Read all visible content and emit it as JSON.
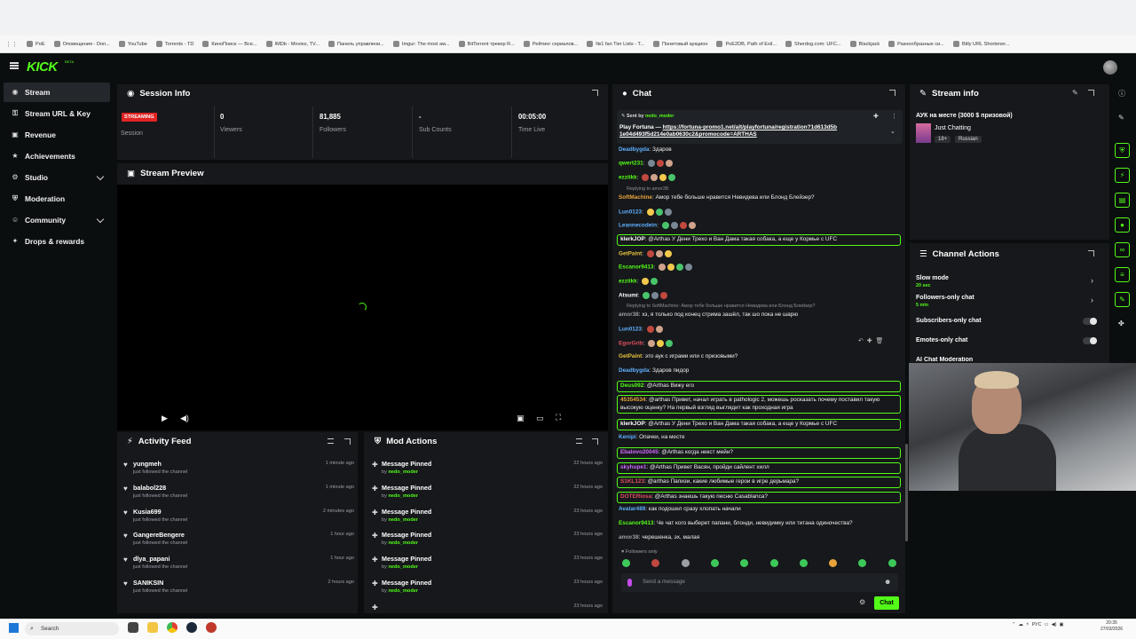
{
  "bookmarks": [
    "PoE",
    "Оповещения - Don...",
    "YouTube",
    "Torrents - TD",
    "КиноПоиск — Все...",
    "IMDb - Movies, TV...",
    "Панель управлени...",
    "Imgur: The most aw...",
    "BitTorrent трекер R...",
    "Рейтинг сериалов...",
    "№1 fan Tier Lists - T...",
    "Понитовый аукцион",
    "PoE2DB, Path of Exil...",
    "Sherdog.com: UFC...",
    "Blackjack",
    "Разнообразные си...",
    "Bitly URL Shortener..."
  ],
  "brand": {
    "logo": "KICK",
    "beta": "BETA",
    "accent": "#53fc18"
  },
  "sidebar": {
    "items": [
      {
        "label": "Stream",
        "icon": "radio-icon"
      },
      {
        "label": "Stream URL & Key",
        "icon": "key-icon"
      },
      {
        "label": "Revenue",
        "icon": "revenue-icon"
      },
      {
        "label": "Achievements",
        "icon": "star-icon"
      },
      {
        "label": "Studio",
        "icon": "studio-icon"
      },
      {
        "label": "Moderation",
        "icon": "shield-icon"
      },
      {
        "label": "Community",
        "icon": "people-icon"
      },
      {
        "label": "Drops & rewards",
        "icon": "gift-icon"
      }
    ]
  },
  "session": {
    "title": "Session Info",
    "badge": "STREAMING",
    "status_label": "Session",
    "cells": [
      {
        "value": "0",
        "label": "Viewers"
      },
      {
        "value": "81,885",
        "label": "Followers"
      },
      {
        "value": "-",
        "label": "Sub Counts"
      },
      {
        "value": "00:05:00",
        "label": "Time Live"
      }
    ]
  },
  "preview": {
    "title": "Stream Preview"
  },
  "activity": {
    "title": "Activity Feed",
    "rows": [
      {
        "name": "yungmeh",
        "sub": "just followed the channel",
        "time": "1 minute ago"
      },
      {
        "name": "balabol228",
        "sub": "just followed the channel",
        "time": "1 minute ago"
      },
      {
        "name": "Kusia699",
        "sub": "just followed the channel",
        "time": "2 minutes ago"
      },
      {
        "name": "GangereBengere",
        "sub": "just followed the channel",
        "time": "1 hour ago"
      },
      {
        "name": "dlya_papani",
        "sub": "just followed the channel",
        "time": "1 hour ago"
      },
      {
        "name": "SANIKSIN",
        "sub": "just followed the channel",
        "time": "2 hours ago"
      }
    ]
  },
  "mod": {
    "title": "Mod Actions",
    "by_prefix": "by",
    "rows": [
      {
        "action": "Message Pinned",
        "by": "nedo_moder",
        "time": "22 hours ago"
      },
      {
        "action": "Message Pinned",
        "by": "nedo_moder",
        "time": "22 hours ago"
      },
      {
        "action": "Message Pinned",
        "by": "nedo_moder",
        "time": "23 hours ago"
      },
      {
        "action": "Message Pinned",
        "by": "nedo_moder",
        "time": "23 hours ago"
      },
      {
        "action": "Message Pinned",
        "by": "nedo_moder",
        "time": "23 hours ago"
      },
      {
        "action": "Message Pinned",
        "by": "nedo_moder",
        "time": "23 hours ago"
      },
      {
        "action": "",
        "by": "",
        "time": "23 hours ago"
      }
    ]
  },
  "chat": {
    "title": "Chat",
    "pinned": {
      "sent_by": "Sent by",
      "user": "nedo_moder",
      "text": "Play Fortuna — ",
      "link": "https://fortuna-promo1.net/alt/playfortuna/registration?1d613d5b1e04d493f5d214e0ab0630c2&promocode=ARTHAS"
    },
    "messages": [
      {
        "user": "Deadbygda",
        "color": "#5fb0ff",
        "text": "Здаров",
        "hl": false
      },
      {
        "user": "qwert231",
        "color": "#53fc18",
        "text": "",
        "hl": false
      },
      {
        "user": "ezziikk",
        "color": "#53fc18",
        "text": "",
        "hl": false
      },
      {
        "reply": "Replying to amor38:",
        "user": "SoftMachine",
        "color": "#e8a23b",
        "text": "Амор тебе больше нравится Невидева или Блонд Блейзер?",
        "hl": false
      },
      {
        "user": "Lun0123",
        "color": "#5fb0ff",
        "text": "",
        "hl": false
      },
      {
        "user": "Leannecodein",
        "color": "#5fb0ff",
        "text": "",
        "hl": false
      },
      {
        "user": "klerkJOP",
        "color": "#ffffff",
        "text": "@Arthas У Дени Трехо и Ван Дама такая собака, а еще у Кормье с UFC",
        "hl": true
      },
      {
        "user": "GetPaint",
        "color": "#e8c33b",
        "text": "",
        "hl": false
      },
      {
        "user": "Escanor9413",
        "color": "#53fc18",
        "text": "",
        "hl": false
      },
      {
        "user": "ezziikk",
        "color": "#53fc18",
        "text": "",
        "hl": false
      },
      {
        "user": "Atsumi",
        "color": "#ffffff",
        "text": "",
        "hl": false
      },
      {
        "reply": "Replying to SoftMachine: Амор тебе больше нравится Невидева или Блонд Блейзер?",
        "user": "amor38",
        "color": "#9aa0a6",
        "text": "хз, я только под конец стрима зашёл, так шо пока не шарю",
        "hl": false
      },
      {
        "user": "Lun0123",
        "color": "#5fb0ff",
        "text": "",
        "hl": false
      },
      {
        "user": "EgorGrib",
        "color": "#e04f5f",
        "text": "",
        "hl": false
      },
      {
        "user": "GetPaint",
        "color": "#e8c33b",
        "text": "это аук с играми или с призовыми?",
        "hl": false
      },
      {
        "user": "Deadbygda",
        "color": "#5fb0ff",
        "text": "Здаров пидор",
        "hl": false
      },
      {
        "user": "Deus092",
        "color": "#53fc18",
        "text": "@Arthas Вижу его",
        "hl": true
      },
      {
        "user": "45354534",
        "color": "#e8a23b",
        "text": "@arthas Привет, начал играть в pathologic 2, можешь росказать почему поставил такую высокую оценку? На первый взгляд выглядит как проходная игра",
        "hl": true
      },
      {
        "user": "klerkJOP",
        "color": "#ffffff",
        "text": "@Arthas У Дени Трехо и Ван Дама такая собака, а еще у Кормье с UFC",
        "hl": true
      },
      {
        "user": "Kenipi",
        "color": "#5fb0ff",
        "text": "Опачки, на месте",
        "hl": false
      },
      {
        "user": "Ebalovo20045",
        "color": "#d06bff",
        "text": "@Arthas когда некст мейн?",
        "hl": true
      },
      {
        "user": "skyhupe1",
        "color": "#d06bff",
        "text": "@Arthas Привет Васян, пройди сайлент хилл",
        "hl": true
      },
      {
        "user": "S1KL123",
        "color": "#e04f5f",
        "text": "@arthas Папизи, какие любимые герои в игре дерьмара?",
        "hl": true
      },
      {
        "user": "DOTERiosa",
        "color": "#e04f5f",
        "text": "@Arthas знаешь такую песню Casablanca?",
        "hl": true
      },
      {
        "user": "Avatar489",
        "color": "#5fb0ff",
        "text": "как подошел сразу хлопать начали",
        "hl": false
      },
      {
        "user": "Escanor9413",
        "color": "#53fc18",
        "text": "Че чат кого выберет папани, блонди, невидимку или титана одиночества?",
        "hl": false
      },
      {
        "user": "amor38",
        "color": "#9aa0a6",
        "text": "черешенка, эх, малая",
        "hl": false
      }
    ],
    "followers_only": "Followers only",
    "input_placeholder": "Send a message",
    "send_label": "Chat"
  },
  "stream_info": {
    "title": "Stream info",
    "stream_title": "АУК на месте (3000 $ призовой)",
    "category": "Just Chatting",
    "tags": [
      "18+",
      "Russian"
    ]
  },
  "channel_actions": {
    "title": "Channel Actions",
    "rows": [
      {
        "label": "Slow mode",
        "sub": "20 sec"
      },
      {
        "label": "Followers-only chat",
        "sub": "5 min"
      },
      {
        "label": "Subscribers-only chat",
        "sub": ""
      },
      {
        "label": "Emotes-only chat",
        "sub": ""
      },
      {
        "label": "AI Chat Moderation",
        "sub": ""
      }
    ]
  },
  "taskbar": {
    "search": "Search",
    "lang": "РУС",
    "time": "20:35",
    "date": "27/03/2026"
  }
}
